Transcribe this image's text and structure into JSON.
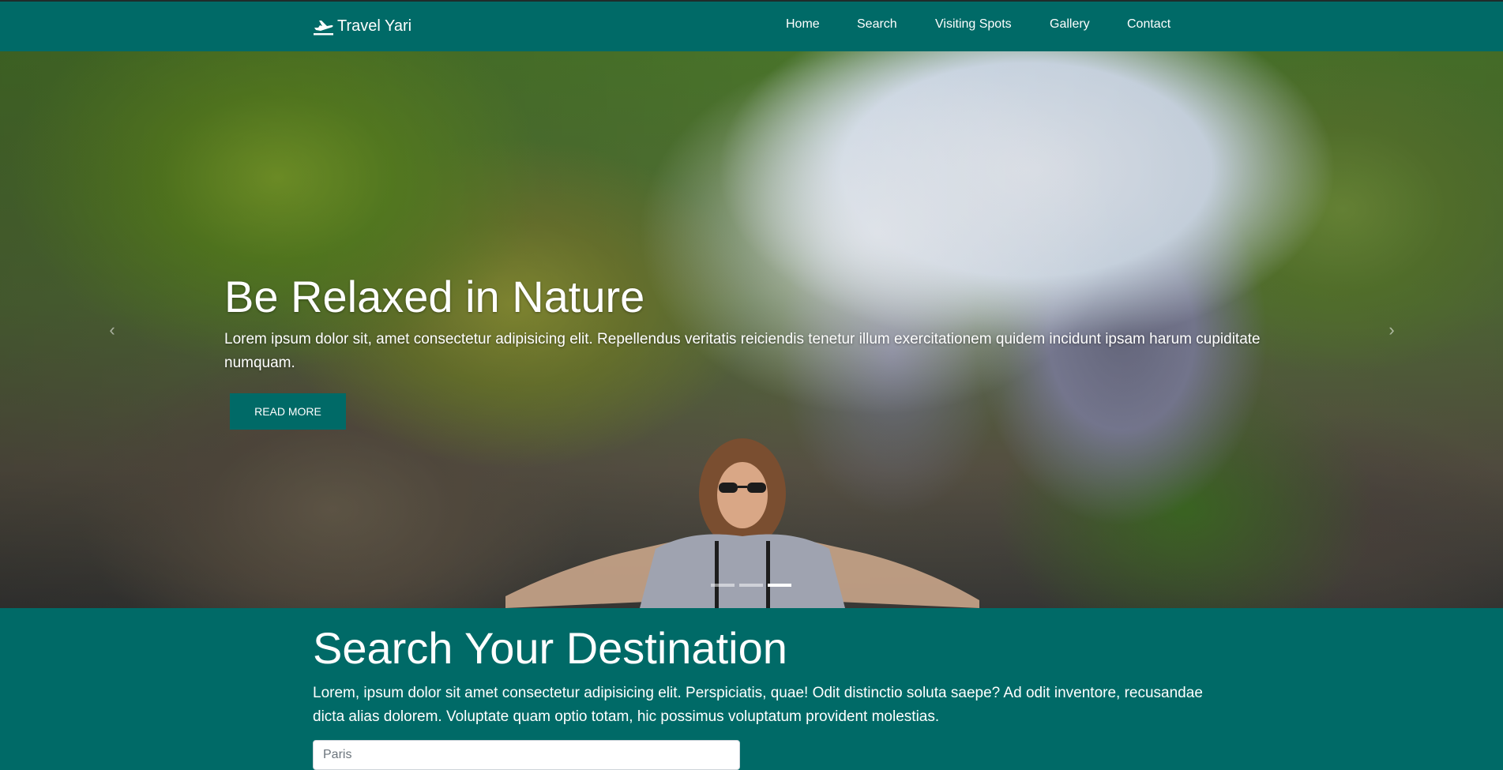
{
  "navbar": {
    "brand": "Travel Yari",
    "brand_icon": "airplane-icon",
    "links": [
      {
        "label": "Home"
      },
      {
        "label": "Search"
      },
      {
        "label": "Visiting Spots"
      },
      {
        "label": "Gallery"
      },
      {
        "label": "Contact"
      }
    ]
  },
  "hero": {
    "title": "Be Relaxed in Nature",
    "text": "Lorem ipsum dolor sit, amet consectetur adipisicing elit. Repellendus veritatis reiciendis tenetur illum exercitationem quidem incidunt ipsam harum cupiditate numquam.",
    "button_label": "READ MORE",
    "prev_icon": "chevron-left-icon",
    "next_icon": "chevron-right-icon",
    "slide_count": 3,
    "active_slide": 3
  },
  "search": {
    "title": "Search Your Destination",
    "text": "Lorem, ipsum dolor sit amet consectetur adipisicing elit. Perspiciatis, quae! Odit distinctio soluta saepe? Ad odit inventore, recusandae dicta alias dolorem. Voluptate quam optio totam, hic possimus voluptatum provident molestias.",
    "placeholder": "Paris"
  },
  "colors": {
    "primary": "#006a67",
    "text": "#ffffff"
  }
}
